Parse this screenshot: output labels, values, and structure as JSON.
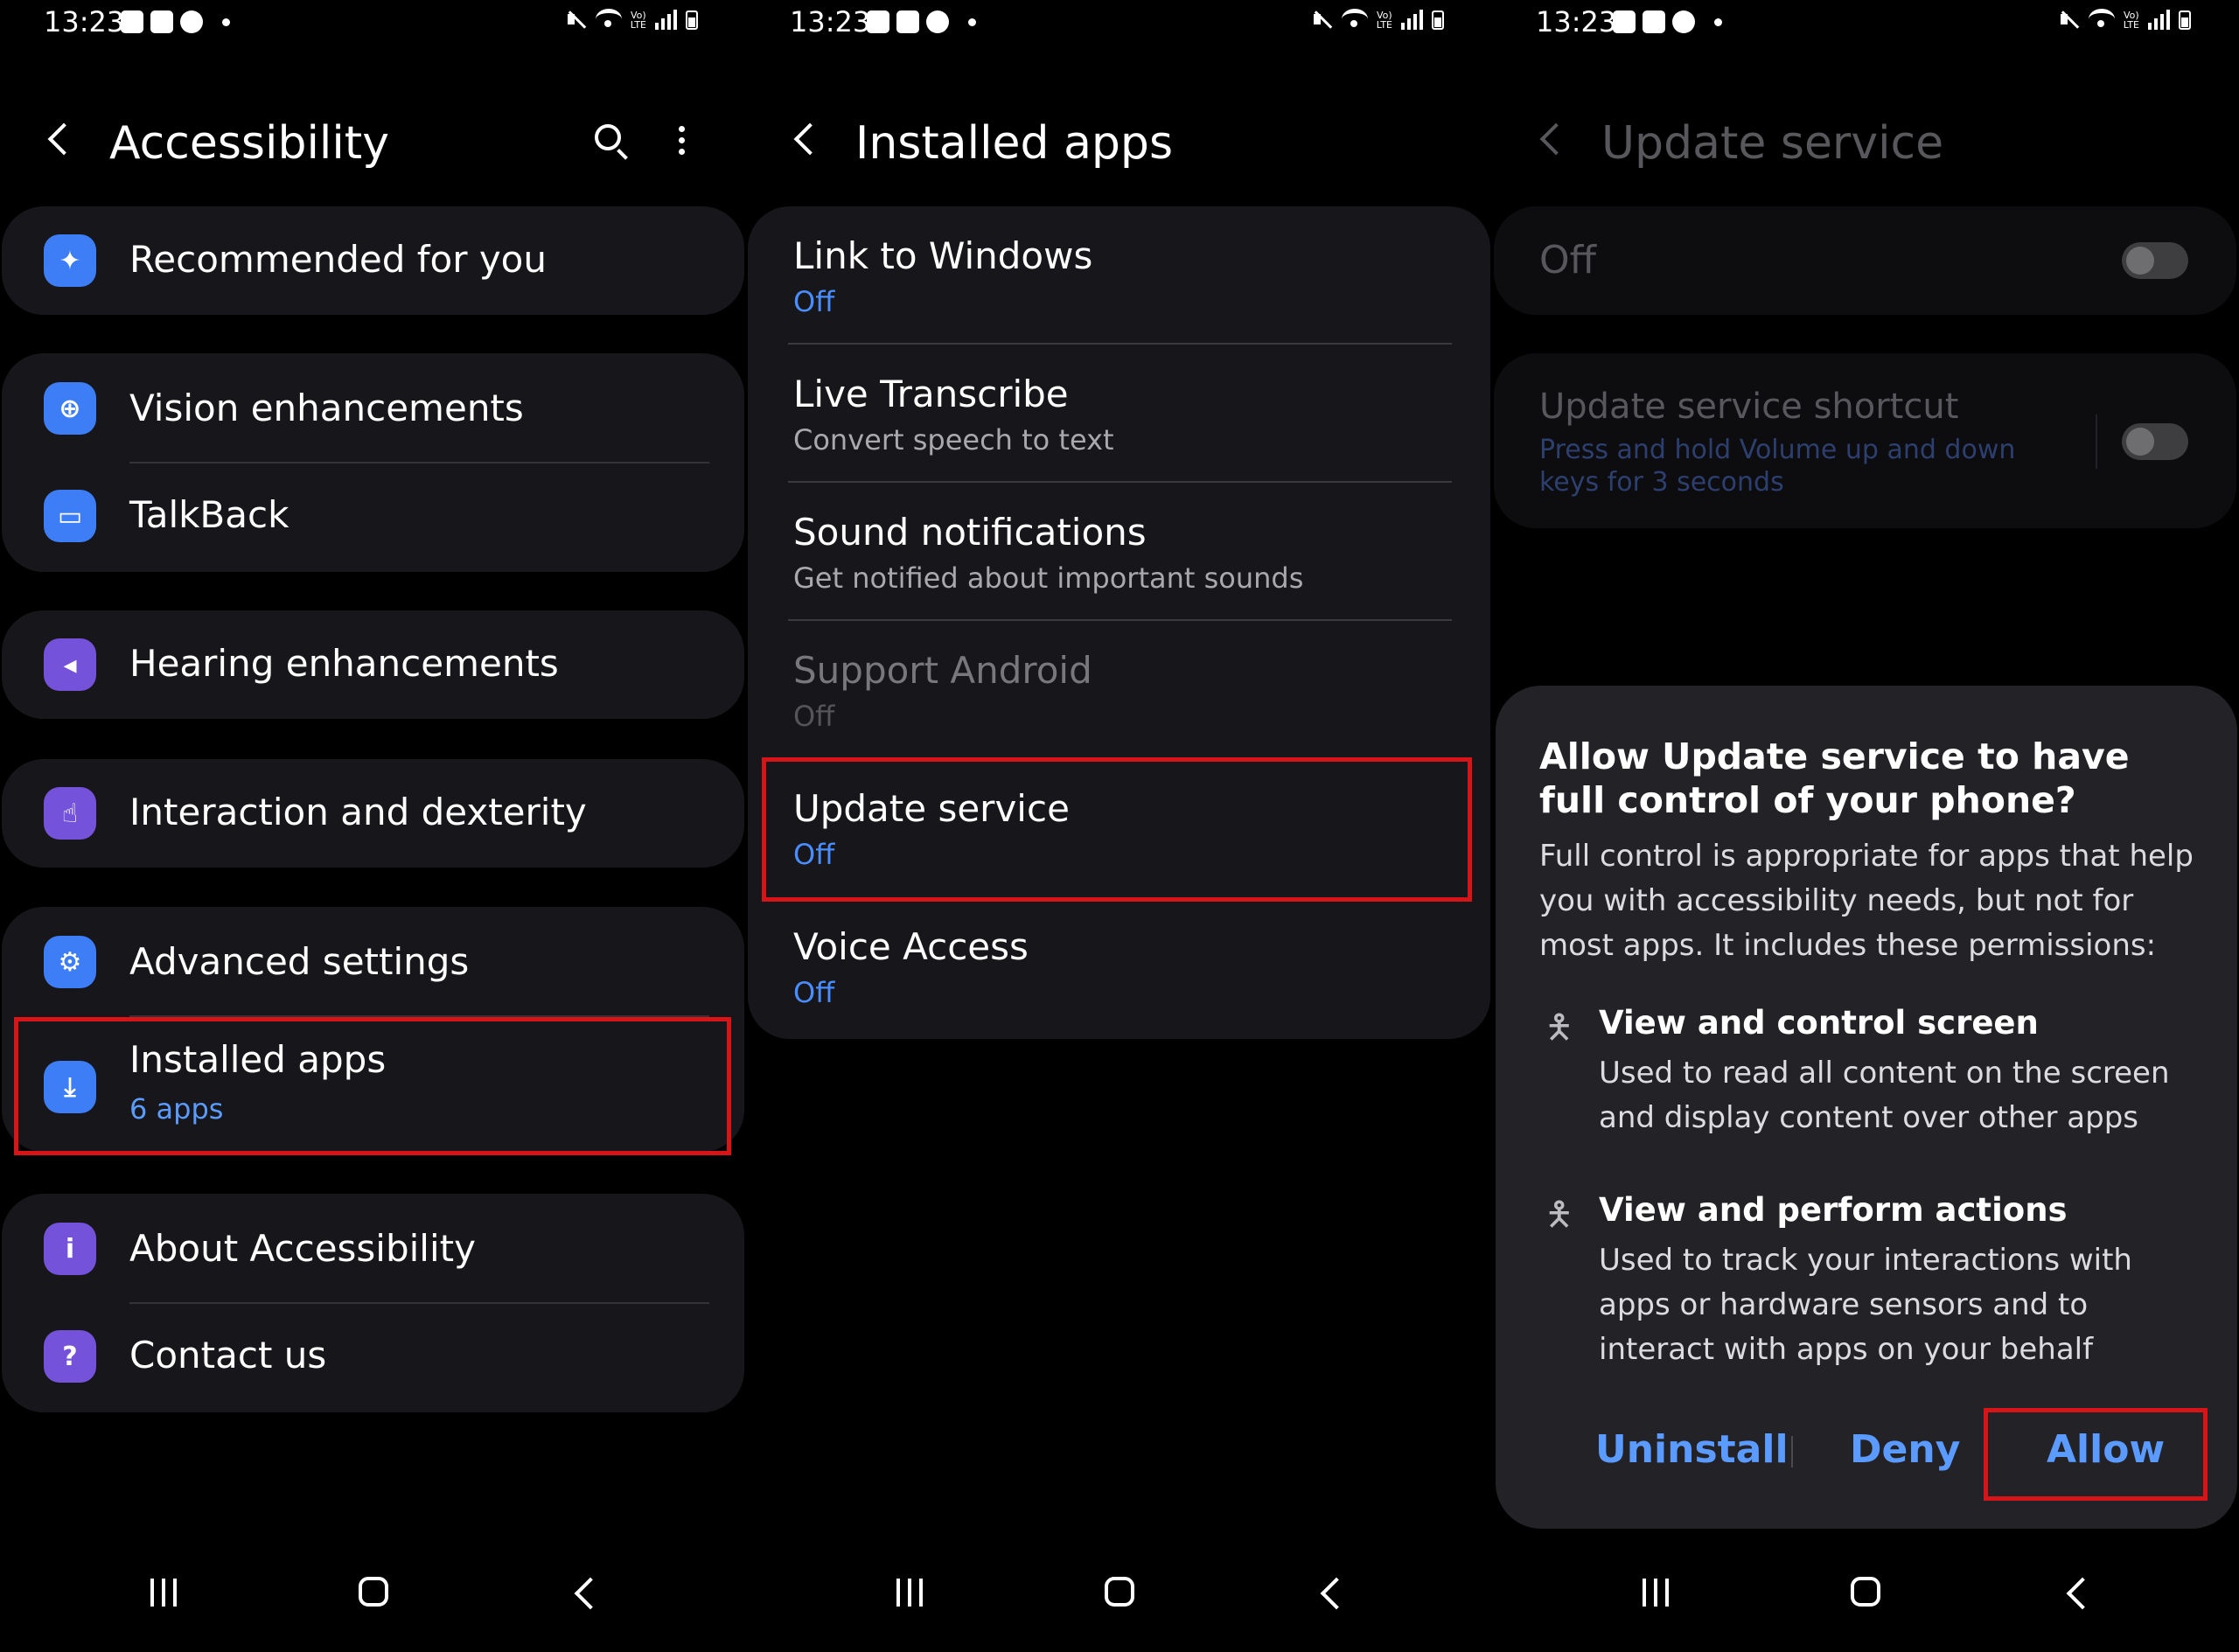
{
  "status": {
    "time": "13:23"
  },
  "accessibility": {
    "title": "Accessibility",
    "items": [
      {
        "label": "Recommended for you"
      },
      {
        "label": "Vision enhancements"
      },
      {
        "label": "TalkBack"
      },
      {
        "label": "Hearing enhancements"
      },
      {
        "label": "Interaction and dexterity"
      },
      {
        "label": "Advanced settings"
      },
      {
        "label": "Installed apps",
        "sub": "6 apps"
      },
      {
        "label": "About Accessibility"
      },
      {
        "label": "Contact us"
      }
    ]
  },
  "installed": {
    "title": "Installed apps",
    "apps": [
      {
        "name": "Link to Windows",
        "status": "Off"
      },
      {
        "name": "Live Transcribe",
        "status": "Convert speech to text"
      },
      {
        "name": "Sound notifications",
        "status": "Get notified about important sounds"
      },
      {
        "name": "Support Android",
        "status": "Off"
      },
      {
        "name": "Update service",
        "status": "Off"
      },
      {
        "name": "Voice Access",
        "status": "Off"
      }
    ]
  },
  "update": {
    "title": "Update service",
    "toggle_label": "Off",
    "shortcut_title": "Update service shortcut",
    "shortcut_desc": "Press and hold Volume up and down keys for 3 seconds",
    "dialog": {
      "title": "Allow Update service to have full control of your phone?",
      "body": "Full control is appropriate for apps that help you with accessibility needs, but not for most apps. It includes these permissions:",
      "perms": [
        {
          "title": "View and control screen",
          "desc": "Used to read all content on the screen and display content over other apps"
        },
        {
          "title": "View and perform actions",
          "desc": "Used to track your interactions with apps or hardware sensors and to interact with apps on your behalf"
        }
      ],
      "buttons": {
        "uninstall": "Uninstall",
        "deny": "Deny",
        "allow": "Allow"
      }
    }
  },
  "colors": {
    "accent": "#5b9bff",
    "highlight": "#d71417",
    "card": "#17171b"
  }
}
